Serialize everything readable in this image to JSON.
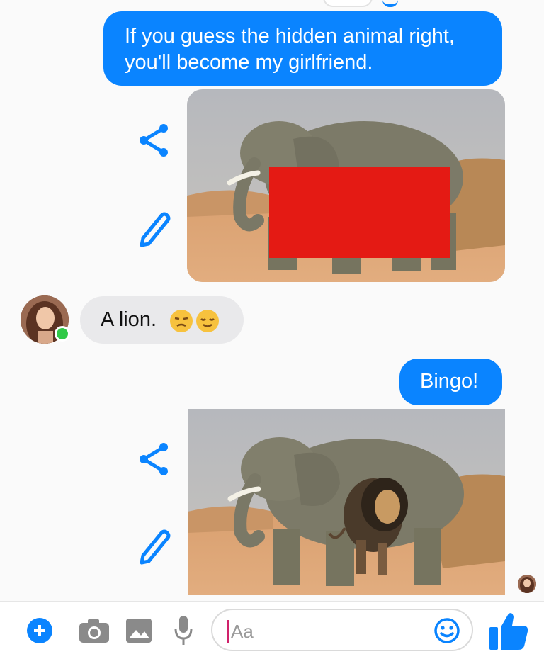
{
  "messages": [
    {
      "type": "text",
      "direction": "outgoing",
      "text": "If you guess the hidden animal right,\nyou'll become my girlfriend."
    },
    {
      "type": "image",
      "direction": "outgoing",
      "description_icon": "elephant-censored-photo"
    },
    {
      "type": "text",
      "direction": "incoming",
      "text": "A lion.",
      "emojis": [
        "unamused-face-emoji",
        "relieved-face-emoji"
      ]
    },
    {
      "type": "text",
      "direction": "outgoing",
      "text": "Bingo!"
    },
    {
      "type": "image",
      "direction": "outgoing",
      "description_icon": "elephant-lion-photo"
    }
  ],
  "composer": {
    "placeholder": "Aa",
    "icons": [
      "plus-icon",
      "camera-icon",
      "gallery-icon",
      "microphone-icon",
      "emoji-icon",
      "thumbs-up-icon"
    ]
  },
  "colors": {
    "accent": "#0a84ff",
    "incoming_bubble": "#e9e9eb",
    "online_dot": "#31c948",
    "censor_box": "#e41a14"
  }
}
